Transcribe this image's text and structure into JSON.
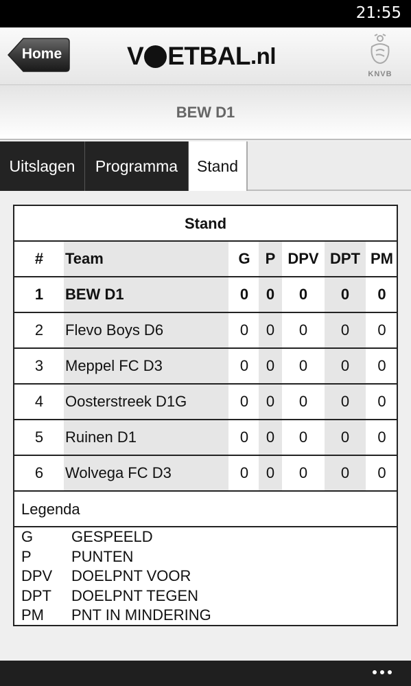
{
  "status": {
    "time": "21:55"
  },
  "header": {
    "home_label": "Home",
    "logo": {
      "prefix": "V",
      "suffix": "ETBAL",
      "tld": ".nl"
    },
    "badge_text": "KNVB"
  },
  "subheader": {
    "title": "BEW D1"
  },
  "tabs": [
    {
      "label": "Uitslagen",
      "active": false
    },
    {
      "label": "Programma",
      "active": false
    },
    {
      "label": "Stand",
      "active": true
    }
  ],
  "standings": {
    "caption": "Stand",
    "columns": [
      "#",
      "Team",
      "G",
      "P",
      "DPV",
      "DPT",
      "PM"
    ],
    "rows": [
      {
        "pos": "1",
        "team": "BEW D1",
        "g": "0",
        "p": "0",
        "dpv": "0",
        "dpt": "0",
        "pm": "0",
        "highlight": true
      },
      {
        "pos": "2",
        "team": "Flevo Boys D6",
        "g": "0",
        "p": "0",
        "dpv": "0",
        "dpt": "0",
        "pm": "0"
      },
      {
        "pos": "3",
        "team": "Meppel FC D3",
        "g": "0",
        "p": "0",
        "dpv": "0",
        "dpt": "0",
        "pm": "0"
      },
      {
        "pos": "4",
        "team": "Oosterstreek D1G",
        "g": "0",
        "p": "0",
        "dpv": "0",
        "dpt": "0",
        "pm": "0"
      },
      {
        "pos": "5",
        "team": "Ruinen D1",
        "g": "0",
        "p": "0",
        "dpv": "0",
        "dpt": "0",
        "pm": "0"
      },
      {
        "pos": "6",
        "team": "Wolvega FC D3",
        "g": "0",
        "p": "0",
        "dpv": "0",
        "dpt": "0",
        "pm": "0"
      }
    ]
  },
  "legend": {
    "title": "Legenda",
    "items": [
      {
        "abbr": "G",
        "desc": "GESPEELD"
      },
      {
        "abbr": "P",
        "desc": "PUNTEN"
      },
      {
        "abbr": "DPV",
        "desc": "DOELPNT VOOR"
      },
      {
        "abbr": "DPT",
        "desc": "DOELPNT TEGEN"
      },
      {
        "abbr": "PM",
        "desc": "PNT IN MINDERING"
      }
    ]
  },
  "appbar": {
    "icon": "more-icon"
  }
}
